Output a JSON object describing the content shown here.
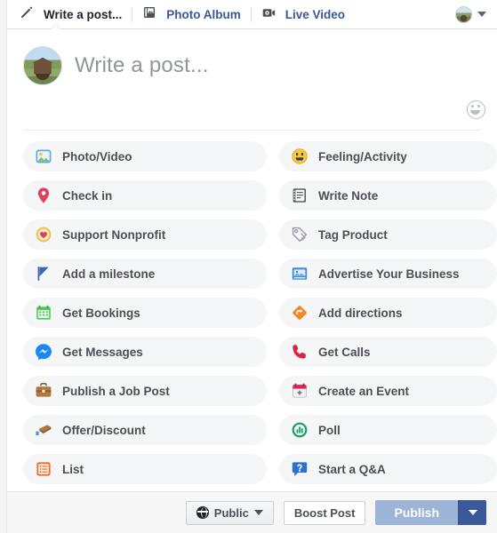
{
  "tabs": [
    {
      "label": "Write a post...",
      "icon": "pencil-icon",
      "active": true
    },
    {
      "label": "Photo Album",
      "icon": "photo-album-icon",
      "active": false
    },
    {
      "label": "Live Video",
      "icon": "video-camera-icon",
      "active": false
    }
  ],
  "composer": {
    "placeholder": "Write a post...",
    "avatar_icon": "user-avatar",
    "emoji_icon": "smiley-face-icon"
  },
  "header": {
    "account_avatar_icon": "account-avatar",
    "account_menu_icon": "chevron-down-icon"
  },
  "options": {
    "left": [
      {
        "label": "Photo/Video",
        "icon": "photo-video-icon"
      },
      {
        "label": "Check in",
        "icon": "location-pin-icon"
      },
      {
        "label": "Support Nonprofit",
        "icon": "donation-heart-icon"
      },
      {
        "label": "Add a milestone",
        "icon": "flag-icon"
      },
      {
        "label": "Get Bookings",
        "icon": "calendar-icon"
      },
      {
        "label": "Get Messages",
        "icon": "messenger-icon"
      },
      {
        "label": "Publish a Job Post",
        "icon": "briefcase-icon"
      },
      {
        "label": "Offer/Discount",
        "icon": "offer-tag-icon"
      },
      {
        "label": "List",
        "icon": "list-icon"
      }
    ],
    "right": [
      {
        "label": "Feeling/Activity",
        "icon": "smiley-emoji-icon"
      },
      {
        "label": "Write Note",
        "icon": "notebook-icon"
      },
      {
        "label": "Tag Product",
        "icon": "price-tag-icon"
      },
      {
        "label": "Advertise Your Business",
        "icon": "advertise-icon"
      },
      {
        "label": "Add directions",
        "icon": "directions-icon"
      },
      {
        "label": "Get Calls",
        "icon": "phone-icon"
      },
      {
        "label": "Create an Event",
        "icon": "event-calendar-icon"
      },
      {
        "label": "Poll",
        "icon": "poll-chart-icon"
      },
      {
        "label": "Start a Q&A",
        "icon": "question-bubble-icon"
      }
    ]
  },
  "footer": {
    "privacy_label": "Public",
    "privacy_icon": "globe-icon",
    "privacy_caret_icon": "chevron-down-icon",
    "boost_label": "Boost Post",
    "publish_label": "Publish",
    "publish_more_icon": "chevron-down-icon"
  },
  "colors": {
    "link_blue": "#365899",
    "brand_blue": "#3b5998",
    "publish_disabled": "#9cb4d8",
    "row_bg": "#f5f6f7",
    "text_dark": "#1d2129",
    "text_muted": "#90949c",
    "label_gray": "#4b4f56"
  }
}
